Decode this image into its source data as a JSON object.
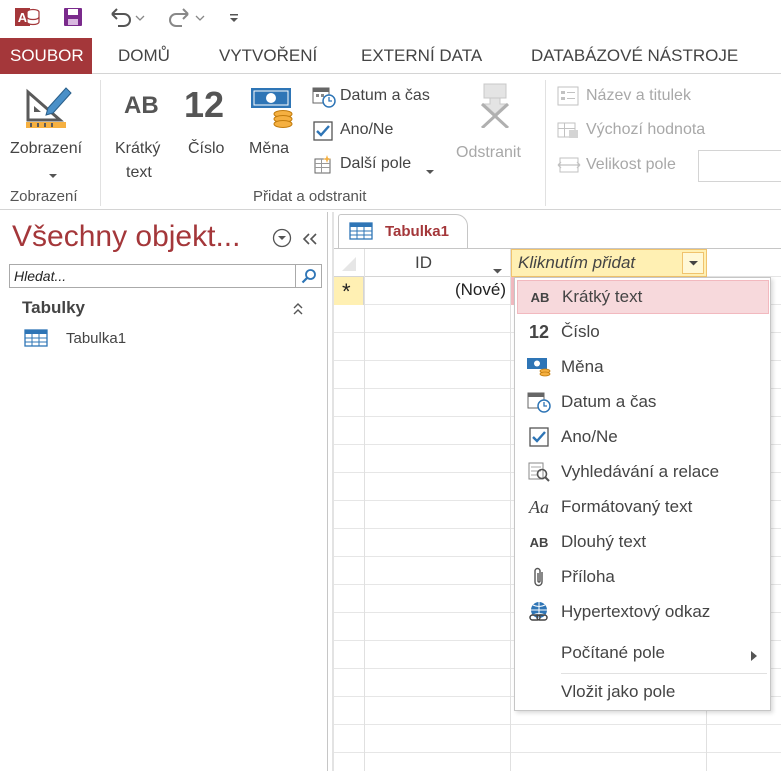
{
  "qat": {
    "app_icon": "access-icon",
    "save_icon": "save-icon",
    "undo_icon": "undo-icon",
    "redo_icon": "redo-icon",
    "customize_icon": "customize-qat-icon"
  },
  "tabs": [
    {
      "label": "SOUBOR"
    },
    {
      "label": "DOMŮ"
    },
    {
      "label": "VYTVOŘENÍ"
    },
    {
      "label": "EXTERNÍ DATA"
    },
    {
      "label": "DATABÁZOVÉ NÁSTROJE"
    }
  ],
  "ribbon": {
    "view_label": "Zobrazení",
    "view_group_label": "Zobrazení",
    "short_text_label_1": "Krátký",
    "short_text_label_2": "text",
    "short_text_glyph": "AB",
    "number_label": "Číslo",
    "number_glyph": "12",
    "currency_label": "Měna",
    "date_time_label": "Datum a čas",
    "yes_no_label": "Ano/Ne",
    "more_fields_label": "Další pole",
    "delete_label": "Odstranit",
    "add_delete_group_label": "Přidat a odstranit",
    "name_caption_label": "Název a titulek",
    "default_value_label": "Výchozí hodnota",
    "field_size_label": "Velikost pole"
  },
  "nav": {
    "title": "Všechny objekt...",
    "search_placeholder": "Hledat...",
    "section_label": "Tabulky",
    "items": [
      {
        "label": "Tabulka1"
      }
    ]
  },
  "doc": {
    "tab_label": "Tabulka1",
    "col_id": "ID",
    "col_add": "Kliknutím přidat",
    "new_row_marker": "*",
    "new_row_value": "(Nové)"
  },
  "menu": {
    "items": [
      {
        "label": "Krátký text",
        "glyph": "AB",
        "icon": "short-text-icon"
      },
      {
        "label": "Číslo",
        "glyph": "12",
        "icon": "number-icon"
      },
      {
        "label": "Měna",
        "icon": "currency-icon"
      },
      {
        "label": "Datum a čas",
        "icon": "date-time-icon"
      },
      {
        "label": "Ano/Ne",
        "icon": "checkbox-icon"
      },
      {
        "label": "Vyhledávání a relace",
        "icon": "lookup-icon"
      },
      {
        "label": "Formátovaný text",
        "glyph": "Aa",
        "icon": "rich-text-icon"
      },
      {
        "label": "Dlouhý text",
        "glyph": "AB",
        "icon": "long-text-icon"
      },
      {
        "label": "Příloha",
        "icon": "paperclip-icon"
      },
      {
        "label": "Hypertextový odkaz",
        "icon": "hyperlink-icon"
      },
      {
        "label": "Počítané pole",
        "icon": "calculated-field-icon"
      },
      {
        "label": "Vložit jako pole",
        "icon": "paste-as-fields-icon"
      }
    ]
  },
  "colors": {
    "accent": "#a4373a",
    "highlight": "#f7d9dc",
    "header_active": "#fff0b3"
  }
}
